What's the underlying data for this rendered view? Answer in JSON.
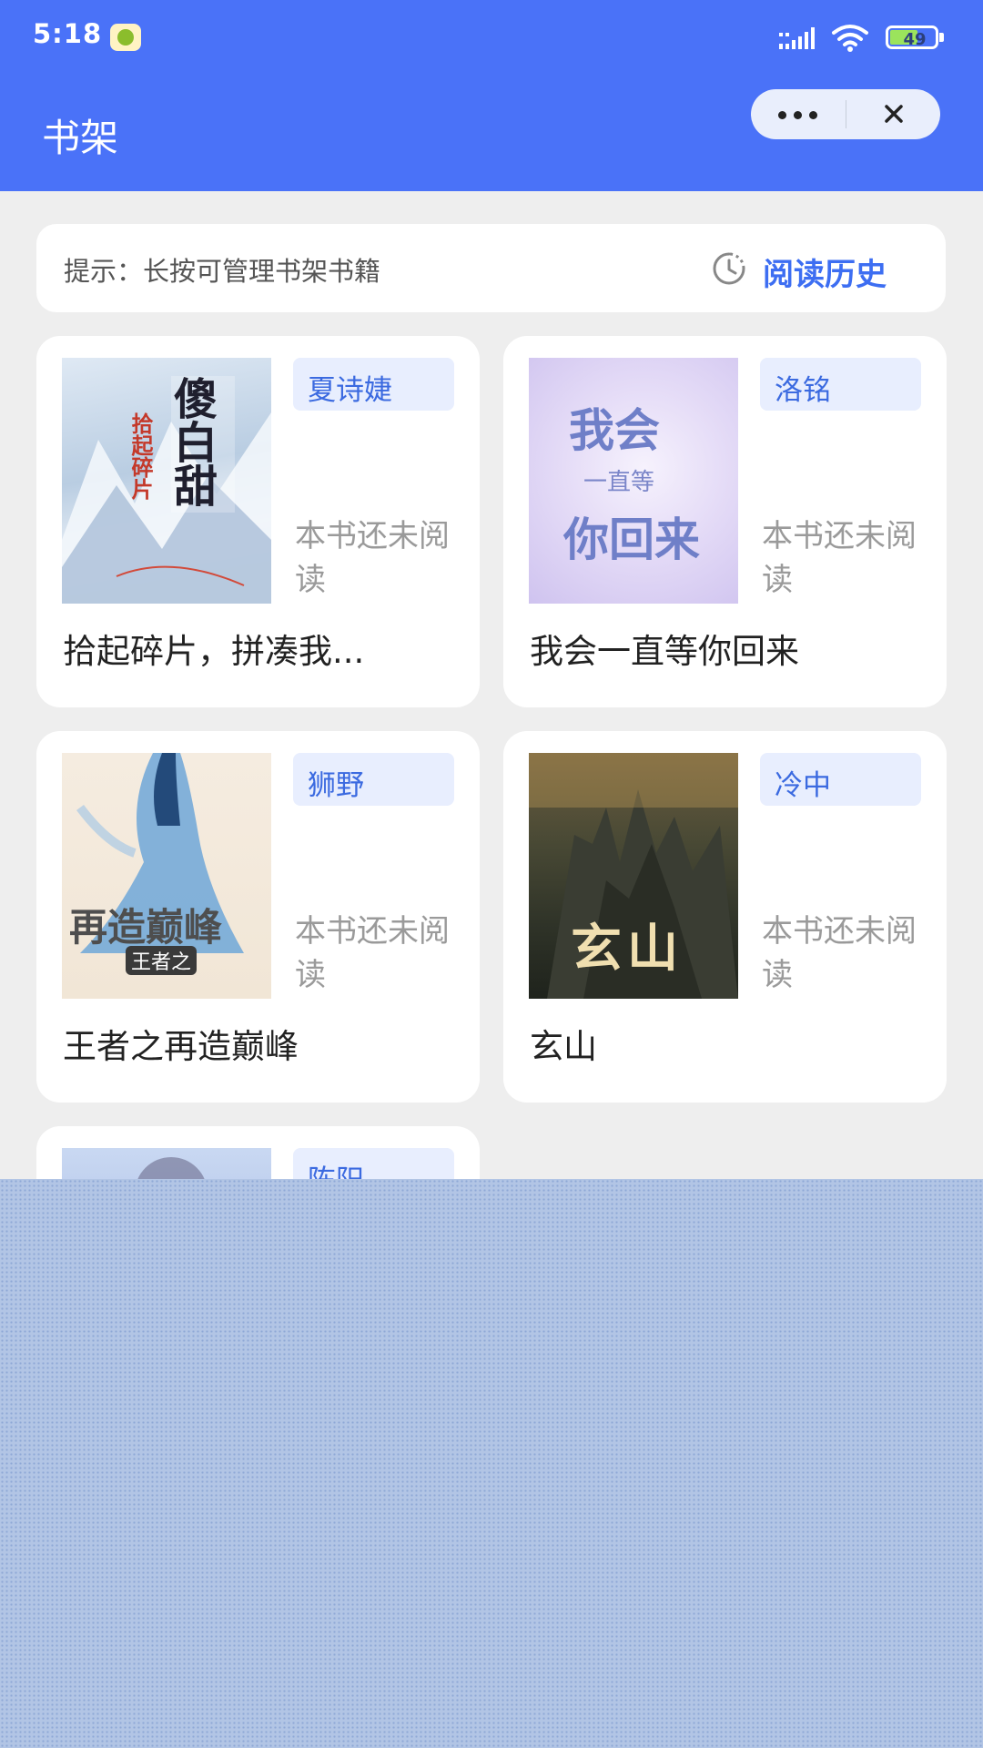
{
  "status_bar": {
    "time": "5:18",
    "battery": "49"
  },
  "header": {
    "title": "书架"
  },
  "tip_bar": {
    "tip": "提示：长按可管理书架书籍",
    "history_label": "阅读历史"
  },
  "books": [
    {
      "title": "拾起碎片，拼凑我...",
      "author": "夏诗婕",
      "status": "本书还未阅读",
      "cover_text": "拾起碎片"
    },
    {
      "title": "我会一直等你回来",
      "author": "洛铭",
      "status": "本书还未阅读",
      "cover_text_top": "我会",
      "cover_text_mid": "一直等",
      "cover_text_bottom": "你回来"
    },
    {
      "title": "王者之再造巅峰",
      "author": "狮野",
      "status": "本书还未阅读",
      "cover_text": "再造巅峰",
      "cover_subtext": "王者之"
    },
    {
      "title": "玄山",
      "author": "冷中",
      "status": "本书还未阅读",
      "cover_text": "玄山"
    },
    {
      "title": "",
      "author": "陈阳",
      "status": ""
    }
  ],
  "colors": {
    "header": "#4a72f8",
    "accent": "#3d6ef2",
    "tag_bg": "#e8eefe",
    "background": "#eeeeee",
    "overlay": "#b2c5e5"
  },
  "icons": {
    "more": "more-dots-icon",
    "close": "close-icon",
    "history": "clock-icon",
    "signal": "signal-icon",
    "wifi": "wifi-icon",
    "battery": "battery-icon"
  }
}
